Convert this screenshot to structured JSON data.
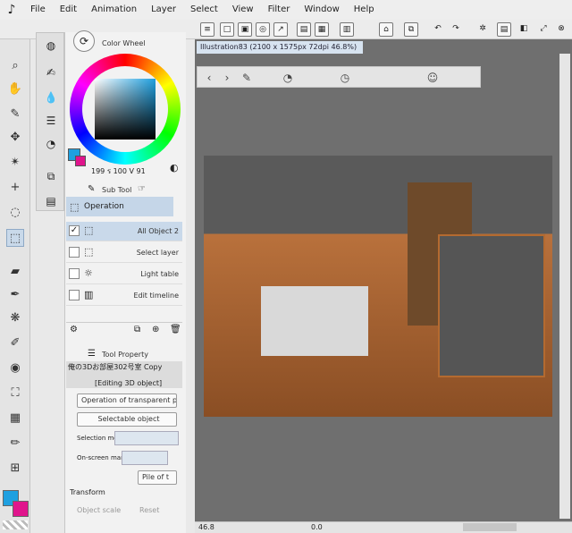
{
  "menu": {
    "items": [
      "File",
      "Edit",
      "Animation",
      "Layer",
      "Select",
      "View",
      "Filter",
      "Window",
      "Help"
    ]
  },
  "color_wheel": {
    "tab_label": "Color Wheel",
    "hsv_readout": "199 ร 100 V 91",
    "main_color": "#1fa0e0",
    "sub_color": "#e0148c"
  },
  "subtool": {
    "tab_label": "Sub Tool",
    "operation_label": "Operation",
    "items": [
      {
        "label": "All Object 2",
        "checked": true
      },
      {
        "label": "Select layer",
        "checked": false
      },
      {
        "label": "Light table",
        "checked": false
      },
      {
        "label": "Edit timeline",
        "checked": false
      }
    ]
  },
  "tool_property": {
    "tab_label": "Tool Property",
    "layer_name": "俺の3Dお部屋302号室 Copy",
    "editing_label": "[Editing 3D object]",
    "transparent_dropdown": "Operation of transparent part",
    "selectable_dropdown": "Selectable object",
    "selection_mode_label": "Selection mo",
    "onscreen_label": "On-screen man",
    "pile_label": "Pile of t",
    "transform_label": "Transform",
    "object_scale_label": "Object scale",
    "reset_label": "Reset"
  },
  "canvas": {
    "file_tab": "Illustration83 (2100 x 1575px 72dpi 46.8%)"
  },
  "status": {
    "zoom": "46.8",
    "rotation": "0.0"
  }
}
